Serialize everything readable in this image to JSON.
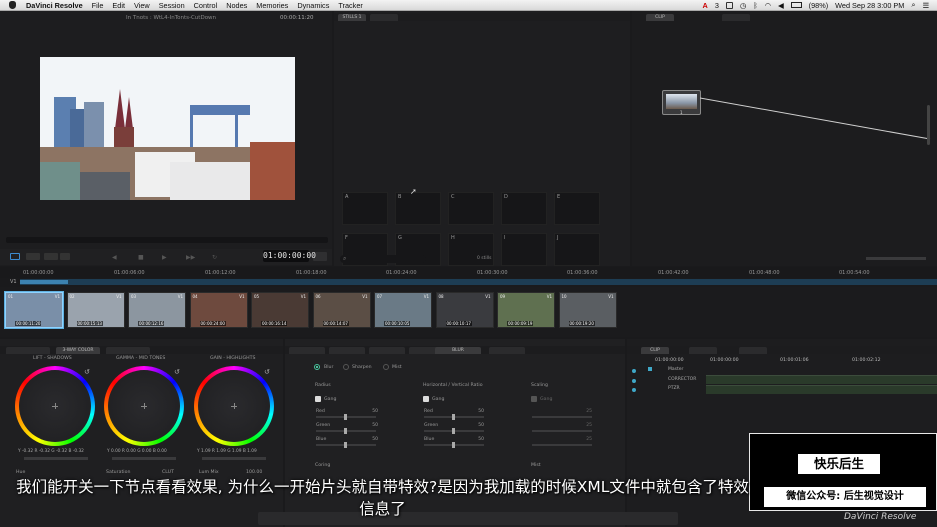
{
  "menubar": {
    "app_name": "DaVinci Resolve",
    "menus": [
      "File",
      "Edit",
      "View",
      "Session",
      "Control",
      "Nodes",
      "Memories",
      "Dynamics",
      "Tracker"
    ],
    "status": {
      "adobe_count": "3",
      "battery": "(98%)",
      "clock": "Wed Sep 28  3:00 PM"
    }
  },
  "viewer": {
    "clip_title": "In Tnots : WtL4-InTonts-CutDown",
    "top_timecode": "00:00:11:20",
    "timecode": "01:00:00:00"
  },
  "stills": {
    "tab_active": "STILLS 1",
    "labels_row1": [
      "A",
      "B",
      "C",
      "D",
      "E"
    ],
    "labels_row2": [
      "F",
      "G",
      "H",
      "I",
      "J"
    ],
    "count": "0 stills"
  },
  "nodes": {
    "tab_active": "CLIP",
    "node_label": "1"
  },
  "timeline": {
    "ruler": [
      "01:00:00:00",
      "01:00:06:00",
      "01:00:12:00",
      "01:00:18:00",
      "01:00:24:00",
      "01:00:30:00",
      "01:00:36:00",
      "01:00:42:00",
      "01:00:48:00",
      "01:00:54:00"
    ],
    "track": "V1",
    "clips": [
      {
        "num": "01",
        "track": "V1",
        "tc": "00:00:11:20"
      },
      {
        "num": "02",
        "track": "V1",
        "tc": "00:00:15:13"
      },
      {
        "num": "03",
        "track": "V1",
        "tc": "00:00:12:16"
      },
      {
        "num": "04",
        "track": "V1",
        "tc": "00:00:24:00"
      },
      {
        "num": "05",
        "track": "V1",
        "tc": "00:00:16:14"
      },
      {
        "num": "06",
        "track": "V1",
        "tc": "00:00:14:07"
      },
      {
        "num": "07",
        "track": "V1",
        "tc": "00:00:10:05"
      },
      {
        "num": "08",
        "track": "V1",
        "tc": "00:00:10:17"
      },
      {
        "num": "09",
        "track": "V1",
        "tc": "00:00:09:19"
      },
      {
        "num": "10",
        "track": "V1",
        "tc": "00:00:19:20"
      }
    ]
  },
  "color": {
    "tab_active": "3-WAY COLOR",
    "wheels": [
      {
        "title": "LIFT - SHADOWS",
        "vals": "Y -0.32  R -0.32  G -0.32  B -0.32"
      },
      {
        "title": "GAMMA - MID TONES",
        "vals": "Y 0.00  R 0.00  G 0.00  B 0.00"
      },
      {
        "title": "GAIN - HIGHLIGHTS",
        "vals": "Y 1.09  R 1.09  G 1.09  B 1.09"
      }
    ],
    "footer": [
      "Hue",
      "Saturation",
      "CLUT",
      "Lum Mix",
      "100.00"
    ]
  },
  "blur": {
    "tab_active": "BLUR",
    "modes": [
      "Blur",
      "Sharpen",
      "Mist"
    ],
    "groups": [
      {
        "title": "Radius",
        "gang": "Gang",
        "rows": [
          [
            "Red",
            "50"
          ],
          [
            "Green",
            "50"
          ],
          [
            "Blue",
            "50"
          ]
        ]
      },
      {
        "title": "Horizontal / Vertical Ratio",
        "gang": "Gang",
        "rows": [
          [
            "Red",
            "50"
          ],
          [
            "Green",
            "50"
          ],
          [
            "Blue",
            "50"
          ]
        ]
      },
      {
        "title": "Scaling",
        "gang": "Gang",
        "rows": [
          [
            "",
            "25"
          ],
          [
            "",
            "25"
          ],
          [
            "",
            "25"
          ]
        ]
      }
    ],
    "coring": "Coring",
    "mist": "Mist"
  },
  "keyframes": {
    "tab_active": "CLIP",
    "timecodes": [
      "01:00:00:00",
      "01:00:00:00",
      "01:00:01:06",
      "01:00:02:12"
    ],
    "rows": [
      "Master",
      "CORRECTOR",
      "PTZR"
    ]
  },
  "overlay": {
    "subtitle": "我们能开关一下节点看看效果, 为什么一开始片头就自带特效?是因为我加载的时候XML文件中就包含了特效信息了",
    "wm_title": "快乐后生",
    "wm_sub": "微信公众号: 后生视觉设计",
    "brand": "DaVinci Resolve"
  }
}
